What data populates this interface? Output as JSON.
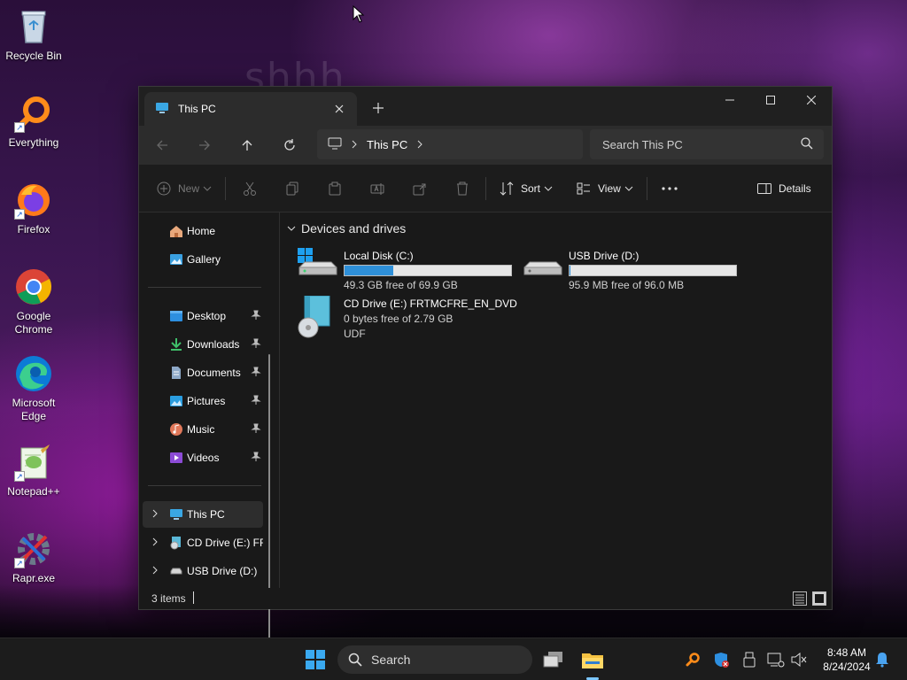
{
  "wallpaper": {
    "overlay_text": "shhh"
  },
  "desktop": {
    "icons": [
      {
        "label": "Recycle Bin",
        "icon": "recycle-bin-icon"
      },
      {
        "label": "Everything",
        "icon": "everything-search-icon"
      },
      {
        "label": "Firefox",
        "icon": "firefox-icon"
      },
      {
        "label": "Google Chrome",
        "icon": "chrome-icon"
      },
      {
        "label": "Microsoft Edge",
        "icon": "edge-icon"
      },
      {
        "label": "Notepad++",
        "icon": "notepad-plus-plus-icon"
      },
      {
        "label": "Rapr.exe",
        "icon": "rapr-icon"
      }
    ]
  },
  "window": {
    "tab_label": "This PC",
    "address": {
      "crumb": "This PC"
    },
    "search": {
      "placeholder": "Search This PC"
    },
    "toolbar": {
      "new_label": "New",
      "sort_label": "Sort",
      "view_label": "View",
      "details_label": "Details"
    },
    "sidebar": {
      "home": "Home",
      "gallery": "Gallery",
      "quick": [
        {
          "label": "Desktop",
          "icon": "desktop-folder-icon"
        },
        {
          "label": "Downloads",
          "icon": "downloads-folder-icon"
        },
        {
          "label": "Documents",
          "icon": "documents-folder-icon"
        },
        {
          "label": "Pictures",
          "icon": "pictures-folder-icon"
        },
        {
          "label": "Music",
          "icon": "music-folder-icon"
        },
        {
          "label": "Videos",
          "icon": "videos-folder-icon"
        }
      ],
      "tree": [
        {
          "label": "This PC",
          "selected": true
        },
        {
          "label": "CD Drive (E:) FRTMCFRE_EN_DVD"
        },
        {
          "label": "USB Drive (D:)"
        }
      ]
    },
    "content": {
      "group_title": "Devices and drives",
      "drives": [
        {
          "name": "Local Disk (C:)",
          "free_text": "49.3 GB free of 69.9 GB",
          "used_fraction": 0.295
        },
        {
          "name": "USB Drive (D:)",
          "free_text": "95.9 MB free of 96.0 MB",
          "used_fraction": 0.001
        },
        {
          "name": "CD Drive (E:) FRTMCFRE_EN_DVD",
          "free_text": "0 bytes free of 2.79 GB",
          "fs": "UDF"
        }
      ]
    },
    "status": {
      "items": "3 items"
    }
  },
  "taskbar": {
    "search_label": "Search",
    "time": "8:48 AM",
    "date": "8/24/2024"
  },
  "colors": {
    "accent": "#2e8fd8",
    "window_bg": "#191919"
  }
}
